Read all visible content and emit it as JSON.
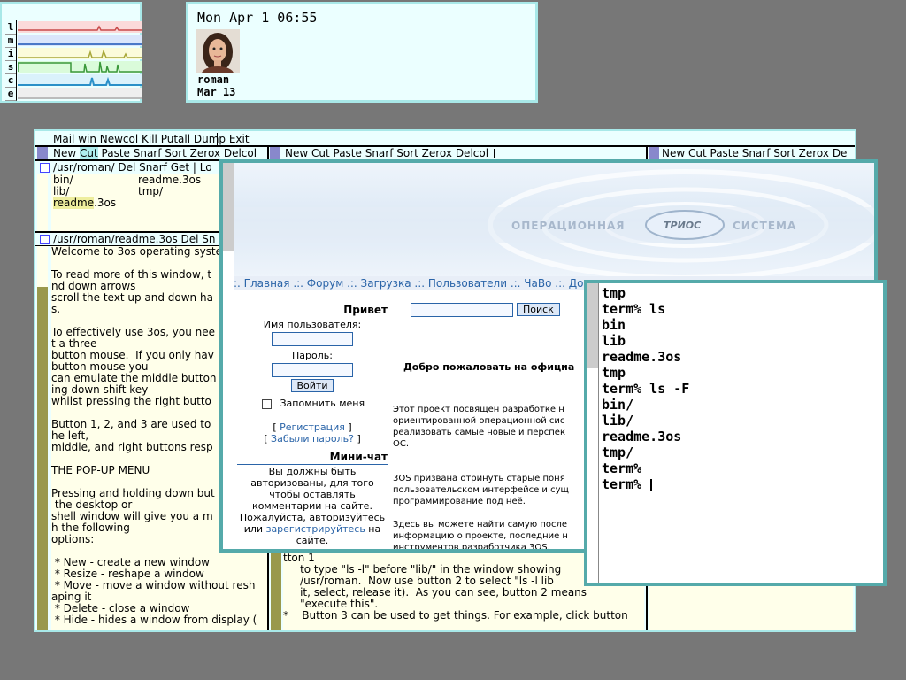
{
  "stats": {
    "labels": [
      "l",
      "m",
      "i",
      "s",
      "c",
      "e"
    ],
    "colors": [
      "#c84a4a",
      "#4a78c8",
      "#c8c84a",
      "#4aa84a",
      "#4aa0c8",
      "#888888"
    ]
  },
  "clock": {
    "datetime": "Mon  Apr 1  06:55",
    "user": "roman",
    "user_date": "Mar 13"
  },
  "acme": {
    "main_tag": "Mail win Newcol Kill Putall Dump Exit",
    "col1_tag_parts": [
      "New ",
      "Cut",
      " Paste Snarf Sort Zerox Delcol"
    ],
    "col2_tag": "New Cut Paste Snarf Sort Zerox Delcol",
    "col3_tag": "New Cut Paste Snarf Sort Zerox De",
    "dir_tag": "/usr/roman/ Del Snarf Get | Lo",
    "dir_left": [
      "bin/",
      "lib/"
    ],
    "dir_right": [
      "readme.3os",
      "tmp/"
    ],
    "dir_selected": "readme",
    "dir_selected_rest": ".3os",
    "readme_tag": "/usr/roman/readme.3os Del Sn",
    "readme_body": "Welcome to 3os operating syste\n\nTo read more of this window, t\nnd down arrows\nscroll the text up and down ha\ns.\n\nTo effectively use 3os, you nee\nt a three\nbutton mouse.  If you only hav\nbutton mouse you\ncan emulate the middle button\ning down shift key\nwhilst pressing the right butto\n\nButton 1, 2, and 3 are used to\nhe left,\nmiddle, and right buttons resp\n\nTHE POP-UP MENU\n\nPressing and holding down but\n the desktop or\nshell window will give you a m\nh the following\noptions:\n\n * New - create a new window\n * Resize - reshape a window\n * Move - move a window without resh\naping it\n * Delete - close a window\n * Hide - hides a window from display (",
    "col2_body": "tton 1\n     to type \"ls -l\" before \"lib/\" in the window showing\n     /usr/roman.  Now use button 2 to select \"ls -l lib\n     it, select, release it).  As you can see, button 2 means\n     \"execute this\".\n*    Button 3 can be used to get things. For example, click button"
  },
  "browser": {
    "banner_left": "ОПЕРАЦИОННАЯ",
    "banner_center": "ТРИОС",
    "banner_right": "СИСТЕМА",
    "nav": ":. Главная .:. Форум .:. Загрузка .:. Пользователи .:. ЧаВо .:. Документация .:",
    "login_heading": "Привет",
    "username_label": "Имя пользователя:",
    "password_label": "Пароль:",
    "login_button": "Войти",
    "remember_label": "Запомнить меня",
    "register_link": "Регистрация",
    "forgot_link": "Забыли пароль?",
    "minichat_heading": "Мини-чат",
    "minichat_text": "Вы должны быть авторизованы, для того чтобы оставлять комментарии на сайте. Пожалуйста, авторизуйтесь или",
    "minichat_link": "зарегистрируйтесь",
    "minichat_tail": " на сайте.",
    "search_button": "Поиск",
    "welcome": "Добро пожаловать на официа",
    "p1": "Этот проект посвящен разработке н\nориентированной операционной сис\nреализовать самые новые и перспек\nОС.",
    "p2": "3OS призвана отринуть старые поня\nпользовательском интерфейсе и сущ\nпрограммирование под неё.",
    "p3": "Здесь вы можете найти самую после\nинформацию о проекте, последние н\nинструментов разработчика 3OS."
  },
  "terminal": {
    "lines": [
      "tmp",
      "term% ls",
      "bin",
      "lib",
      "readme.3os",
      "tmp",
      "term% ls -F",
      "bin/",
      "lib/",
      "readme.3os",
      "tmp/",
      "term%",
      "term% "
    ]
  }
}
